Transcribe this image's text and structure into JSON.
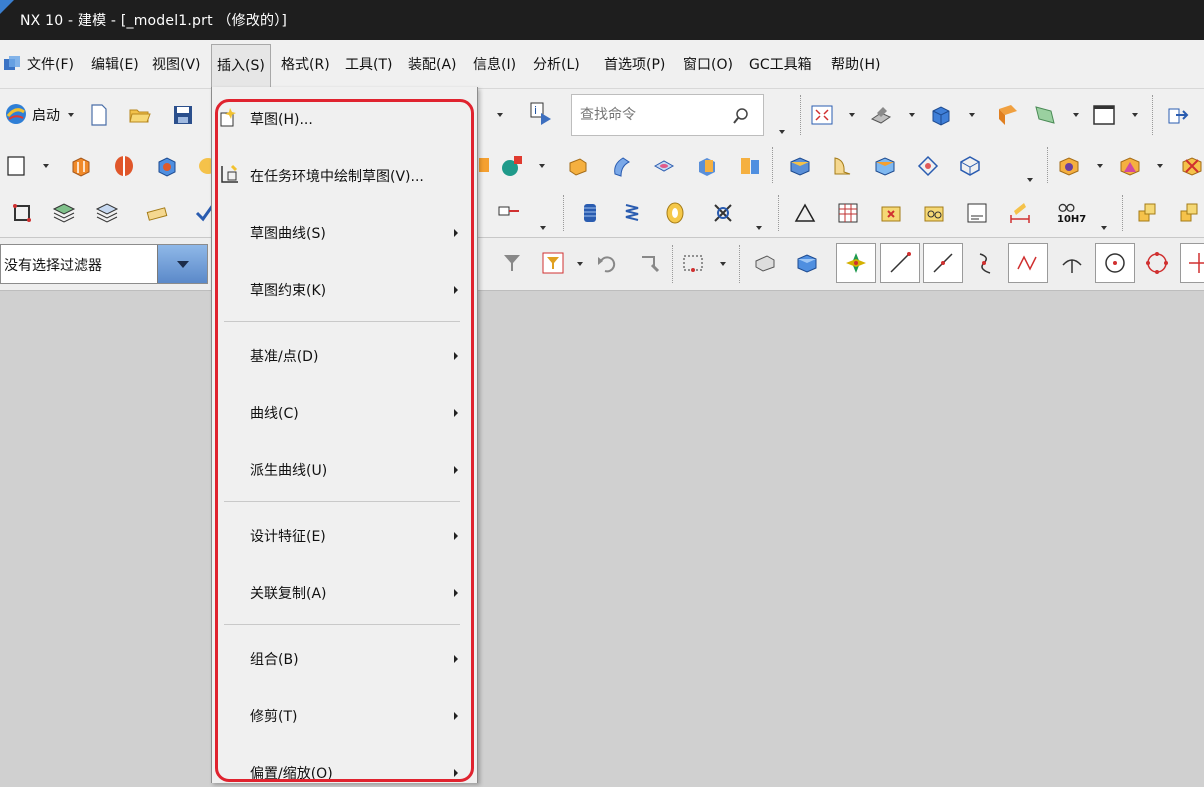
{
  "window": {
    "title": "NX 10 - 建模 - [_model1.prt （修改的）]"
  },
  "menubar": {
    "items": [
      {
        "label": "文件(F)"
      },
      {
        "label": "编辑(E)"
      },
      {
        "label": "视图(V)"
      },
      {
        "label": "插入(S)",
        "active": true
      },
      {
        "label": "格式(R)"
      },
      {
        "label": "工具(T)"
      },
      {
        "label": "装配(A)"
      },
      {
        "label": "信息(I)"
      },
      {
        "label": "分析(L)"
      },
      {
        "label": "首选项(P)"
      },
      {
        "label": "窗口(O)"
      },
      {
        "label": "GC工具箱"
      },
      {
        "label": "帮助(H)"
      }
    ]
  },
  "toolbar": {
    "launch_label": "启动",
    "search_placeholder": "查找命令",
    "hole_fit_label": "10H7"
  },
  "filter": {
    "value": "没有选择过滤器"
  },
  "insert_menu": {
    "items": [
      {
        "label": "草图(H)...",
        "has_icon": true,
        "submenu": false
      },
      {
        "label": "在任务环境中绘制草图(V)...",
        "has_icon": true,
        "submenu": false
      },
      {
        "label": "草图曲线(S)",
        "submenu": true
      },
      {
        "label": "草图约束(K)",
        "submenu": true
      },
      {
        "label": "基准/点(D)",
        "submenu": true
      },
      {
        "label": "曲线(C)",
        "submenu": true
      },
      {
        "label": "派生曲线(U)",
        "submenu": true
      },
      {
        "label": "设计特征(E)",
        "submenu": true
      },
      {
        "label": "关联复制(A)",
        "submenu": true
      },
      {
        "label": "组合(B)",
        "submenu": true
      },
      {
        "label": "修剪(T)",
        "submenu": true
      },
      {
        "label": "偏置/缩放(O)",
        "submenu": true
      }
    ]
  },
  "colors": {
    "highlight": "#e0232f",
    "titlebar": "#1e1e1e",
    "menubar": "#f0f0f0"
  }
}
